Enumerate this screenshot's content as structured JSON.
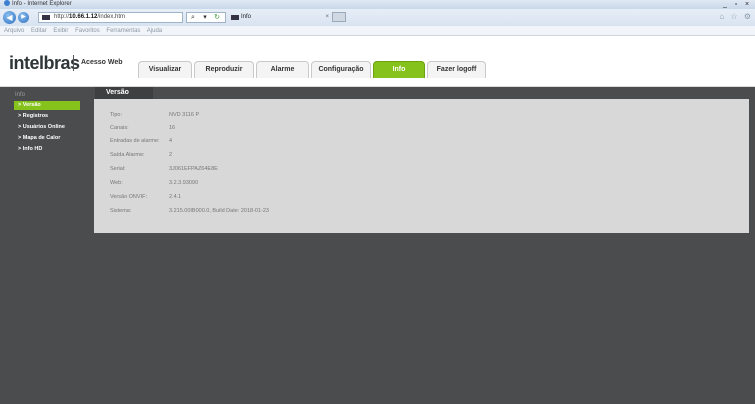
{
  "browser": {
    "title": "Info - Internet Explorer",
    "window_buttons": [
      "_",
      "▫",
      "×"
    ],
    "address": {
      "prefix": "http://",
      "host": "10.66.1.12",
      "path": "/index.htm"
    },
    "address_tools": [
      "⌕",
      "▾",
      "↻"
    ],
    "tab_title": "Info",
    "tab_close": "×",
    "right_icons": "⌂ ☆ ⚙",
    "menu": [
      "Arquivo",
      "Editar",
      "Exibir",
      "Favoritos",
      "Ferramentas",
      "Ajuda"
    ]
  },
  "app": {
    "logo": "intelbras",
    "brand_label": "Acesso Web",
    "nav_tabs": [
      "Visualizar",
      "Reproduzir",
      "Alarme",
      "Configuração",
      "Info",
      "Fazer logoff"
    ],
    "active_tab": "Info"
  },
  "sidebar": {
    "title": "Info",
    "items": [
      "> Versão",
      "> Registros",
      "> Usuários Online",
      "> Mapa de Calor",
      "> Info HD"
    ]
  },
  "content": {
    "tab": "Versão",
    "rows": [
      {
        "label": "Tipo:",
        "value": "NVD 3116 P"
      },
      {
        "label": "Canais:",
        "value": "16"
      },
      {
        "label": "Entradas de alarme:",
        "value": "4"
      },
      {
        "label": "Saída Alarme:",
        "value": "2"
      },
      {
        "label": "Serial:",
        "value": "3J061EFPAZ64E8E"
      },
      {
        "label": "Web:",
        "value": "3.2.3.93090"
      },
      {
        "label": "Versão ONVIF:",
        "value": "2.4.1"
      },
      {
        "label": "Sistema:",
        "value": "3.215.00IB000.0, Build Date: 2018-01-23"
      }
    ]
  },
  "colors": {
    "accent": "#86c21c",
    "background": "#4b4c4e",
    "panel": "#d8d8d8"
  }
}
